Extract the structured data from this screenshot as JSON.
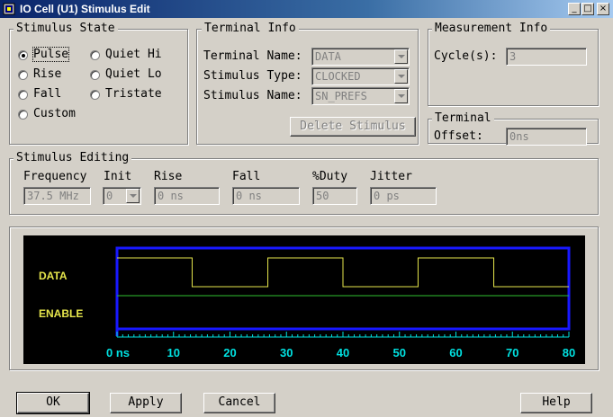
{
  "window": {
    "title": "IO Cell (U1) Stimulus Edit",
    "minimize": "_",
    "maximize": "□",
    "close": "×"
  },
  "stimulus_state": {
    "title": "Stimulus State",
    "options": [
      {
        "label": "Pulse",
        "selected": true
      },
      {
        "label": "Rise",
        "selected": false
      },
      {
        "label": "Fall",
        "selected": false
      },
      {
        "label": "Custom",
        "selected": false
      },
      {
        "label": "Quiet Hi",
        "selected": false
      },
      {
        "label": "Quiet Lo",
        "selected": false
      },
      {
        "label": "Tristate",
        "selected": false
      }
    ]
  },
  "terminal_info": {
    "title": "Terminal Info",
    "name_label": "Terminal Name:",
    "name_value": "DATA",
    "type_label": "Stimulus Type:",
    "type_value": "CLOCKED",
    "stim_name_label": "Stimulus Name:",
    "stim_name_value": "SN_PREFS",
    "delete_button": "Delete Stimulus"
  },
  "measurement_info": {
    "title": "Measurement Info",
    "cycles_label": "Cycle(s):",
    "cycles_value": "3"
  },
  "terminal_offset": {
    "title": "Terminal",
    "offset_label": "Offset:",
    "offset_value": "0ns"
  },
  "stimulus_editing": {
    "title": "Stimulus Editing",
    "frequency_label": "Frequency",
    "frequency_value": "37.5 MHz",
    "init_label": "Init",
    "init_value": "0",
    "rise_label": "Rise",
    "rise_value": "0 ns",
    "fall_label": "Fall",
    "fall_value": "0 ns",
    "duty_label": "%Duty",
    "duty_value": "50",
    "jitter_label": "Jitter",
    "jitter_value": "0 ps"
  },
  "waveform": {
    "signals": [
      "DATA",
      "ENABLE"
    ],
    "axis_ticks": [
      "0 ns",
      "10",
      "20",
      "30",
      "40",
      "50",
      "60",
      "70",
      "80"
    ],
    "axis_range": [
      0,
      80
    ],
    "data_transitions": [
      0,
      13.3,
      26.7,
      40,
      53.3,
      66.7,
      80
    ],
    "data_initial": "high",
    "enable_level": "mid",
    "colors": {
      "background": "#000000",
      "border": "#1818ff",
      "data": "#e6e64c",
      "enable": "#30c030",
      "ticks": "#00e0e0"
    }
  },
  "buttons": {
    "ok": "OK",
    "apply": "Apply",
    "cancel": "Cancel",
    "help": "Help"
  }
}
